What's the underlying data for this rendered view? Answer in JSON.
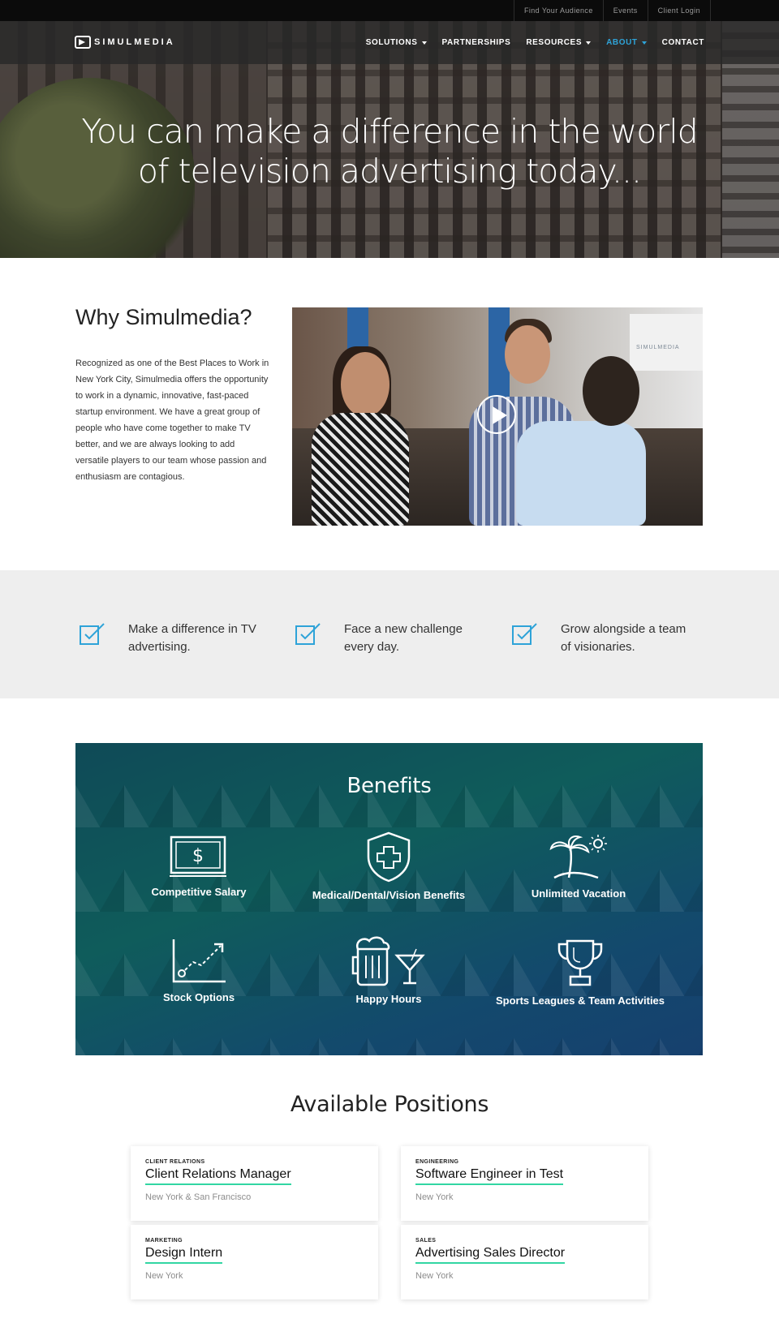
{
  "utility_links": [
    "Find Your Audience",
    "Events",
    "Client Login"
  ],
  "brand": {
    "name": "SIMULMEDIA"
  },
  "nav": [
    {
      "label": "SOLUTIONS",
      "dropdown": true
    },
    {
      "label": "PARTNERSHIPS",
      "dropdown": false
    },
    {
      "label": "RESOURCES",
      "dropdown": true
    },
    {
      "label": "ABOUT",
      "dropdown": true,
      "active": true
    },
    {
      "label": "CONTACT",
      "dropdown": false
    }
  ],
  "hero": {
    "title_line1": "You can make a difference in the world",
    "title_line2": "of television advertising today..."
  },
  "why": {
    "title": "Why Simulmedia?",
    "body": "Recognized as one of the Best Places to Work in New York City, Simulmedia offers the opportunity to work in a dynamic, innovative, fast-paced startup environment. We have a great group of people who have come together to make TV better, and we are always looking to add versatile players to our team whose passion and enthusiasm are contagious.",
    "video_sign": "SIMULMEDIA"
  },
  "values": [
    {
      "icon": "checkbox-icon",
      "text": "Make a difference in TV advertising."
    },
    {
      "icon": "checkbox-icon",
      "text": "Face a new challenge every day."
    },
    {
      "icon": "checkbox-icon",
      "text": "Grow alongside a team of visionaries."
    }
  ],
  "benefits": {
    "title": "Benefits",
    "items": [
      {
        "icon": "dollar-bill-icon",
        "label": "Competitive Salary"
      },
      {
        "icon": "medical-shield-icon",
        "label": "Medical/Dental/Vision Benefits"
      },
      {
        "icon": "palm-tree-icon",
        "label": "Unlimited Vacation"
      },
      {
        "icon": "stock-chart-icon",
        "label": "Stock Options"
      },
      {
        "icon": "beer-cocktail-icon",
        "label": "Happy Hours"
      },
      {
        "icon": "trophy-icon",
        "label": "Sports Leagues & Team Activities"
      }
    ]
  },
  "positions": {
    "title": "Available Positions",
    "items": [
      {
        "dept": "CLIENT RELATIONS",
        "role": "Client Relations Manager",
        "location": "New York & San Francisco"
      },
      {
        "dept": "ENGINEERING",
        "role": "Software Engineer in Test",
        "location": "New York"
      },
      {
        "dept": "MARKETING",
        "role": "Design Intern",
        "location": "New York"
      },
      {
        "dept": "SALES",
        "role": "Advertising Sales Director",
        "location": "New York"
      }
    ]
  },
  "colors": {
    "accent_blue": "#2ea3d8",
    "underline_green": "#32d6a3",
    "benefits_teal": "#0f5c5b"
  }
}
